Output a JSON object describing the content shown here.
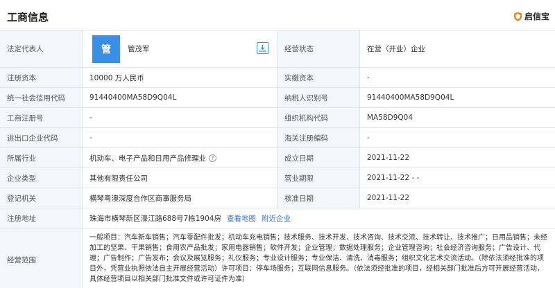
{
  "header": {
    "title": "工商信息",
    "brand": "启信宝"
  },
  "legal_rep": {
    "label": "法定代表人",
    "avatar_text": "管",
    "name": "管茂军"
  },
  "status": {
    "label": "经营状态",
    "value": "在营（开业）企业"
  },
  "rows": [
    {
      "l1": "注册资本",
      "v1": "10000 万人民币",
      "l2": "实缴资本",
      "v2": "-"
    },
    {
      "l1": "统一社会信用代码",
      "v1": "91440400MA58D9Q04L",
      "l2": "纳税人识别号",
      "v2": "91440400MA58D9Q04L"
    },
    {
      "l1": "工商注册号",
      "v1": "-",
      "l2": "组织机构代码",
      "v2": "MA58D9Q04"
    },
    {
      "l1": "进出口企业代码",
      "v1": "-",
      "l2": "海关注册编码",
      "v2": "-"
    },
    {
      "l1": "所属行业",
      "v1": "机动车、电子产品和日用产品修理业",
      "l2": "成立日期",
      "v2": "2021-11-22"
    },
    {
      "l1": "企业类型",
      "v1": "其他有限责任公司",
      "l2": "营业期限",
      "v2": "2021-11-22 - -"
    },
    {
      "l1": "登记机关",
      "v1": "横琴粤澳深度合作区商事服务局",
      "l2": "核准日期",
      "v2": "2021-11-22"
    }
  ],
  "address": {
    "label": "注册地址",
    "value": "珠海市横琴新区濠江路688号7栋1904房",
    "map_link": "查看地图",
    "nearby_link": "附近企业"
  },
  "scope": {
    "label": "经营范围",
    "value": "一般项目：汽车新车销售；汽车零配件批发；机动车充电销售；技术服务、技术开发、技术咨询、技术交流、技术转让、技术推广；日用品销售；未经加工的坚果、干果销售；食用农产品批发；家用电器销售；软件开发；企业管理；数据处理服务；企业管理咨询；社会经济咨询服务；广告设计、代理；广告制作；广告发布；会议及展览服务；礼仪服务；专业设计服务；专业保洁、清洗、消毒服务；组织文化艺术交流活动。（除依法须经批准的项目外，凭营业执照依法自主开展经营活动）许可项目：停车场服务；互联网信息服务。（依法须经批准的项目，经相关部门批准后方可开展经营活动，具体经营项目以相关部门批准文件或许可证件为准）"
  },
  "colors": {
    "label_bg": "#f3f6fa",
    "border": "#e4e4e4",
    "accent": "#3a8ee6",
    "link": "#2f6fd6"
  },
  "icons": {
    "brand": "shield-icon",
    "share": "download-icon",
    "help": "help-circle-icon"
  }
}
